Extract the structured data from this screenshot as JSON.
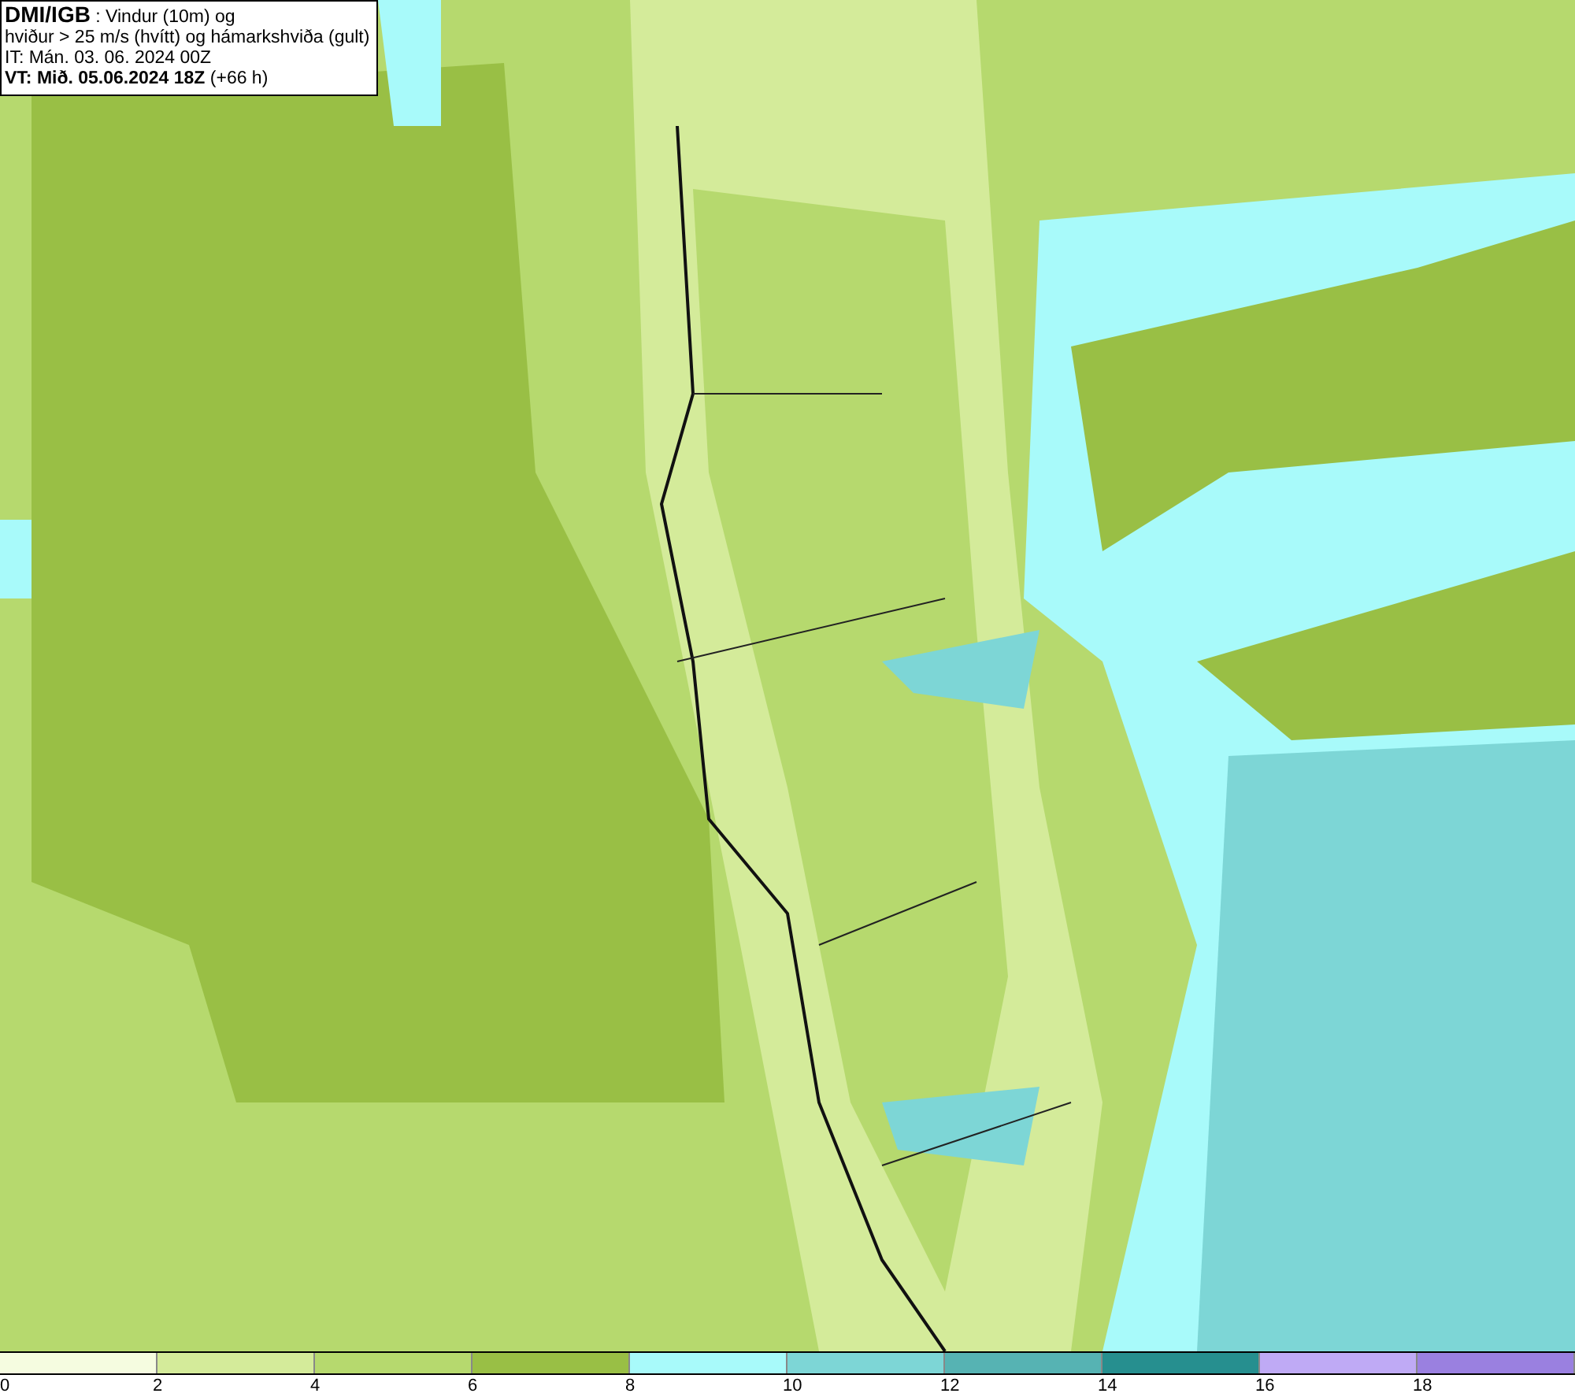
{
  "header": {
    "lines": [
      "**DMI/IGB** : Vindur (10m) og",
      "hviður > 25 m/s (hvítt) og hámarkshviða (gult)",
      "IT: Mán. 03. 06. 2024 00Z",
      "**VT: Mið. 05.06.2024 18Z** (+66 h)"
    ]
  },
  "legend": {
    "items": [
      {
        "color": "#f5fce0",
        "label": "0"
      },
      {
        "color": "#d4eb9a",
        "label": "2"
      },
      {
        "color": "#b6d96e",
        "label": "4"
      },
      {
        "color": "#99bf45",
        "label": "6"
      },
      {
        "color": "#a8fafa",
        "label": "8"
      },
      {
        "color": "#7dd6d6",
        "label": "10"
      },
      {
        "color": "#56b3b3",
        "label": "12"
      },
      {
        "color": "#268f8f",
        "label": "14"
      },
      {
        "color": "#bfaaf5",
        "label": "16"
      },
      {
        "color": "#9a80e0",
        "label": "18"
      }
    ]
  }
}
